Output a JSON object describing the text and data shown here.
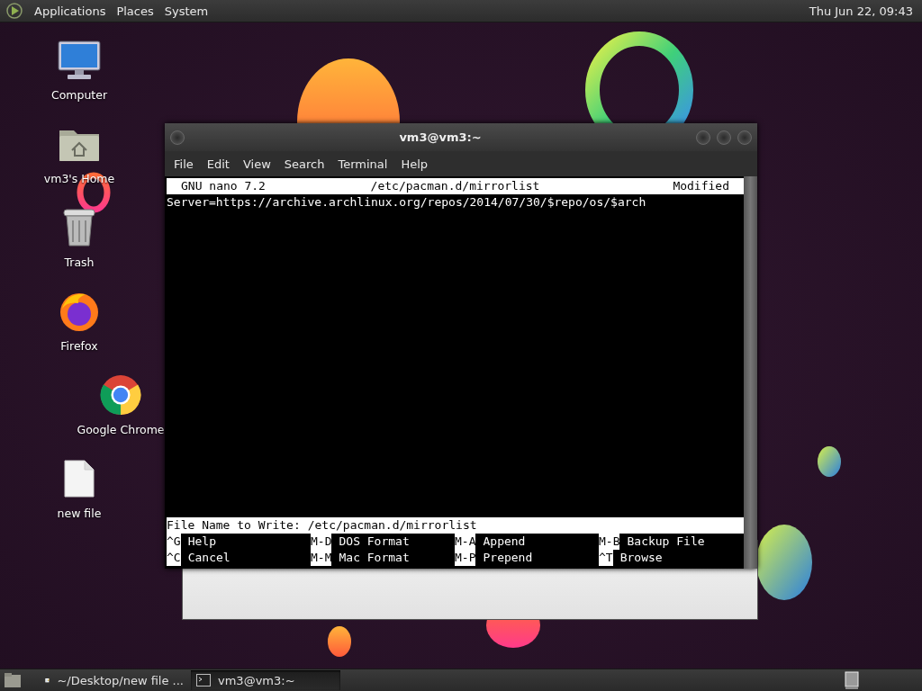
{
  "top_panel": {
    "menus": [
      "Applications",
      "Places",
      "System"
    ],
    "clock": "Thu Jun 22, 09:43"
  },
  "desktop_icons": [
    {
      "label": "Computer",
      "kind": "computer"
    },
    {
      "label": "vm3's Home",
      "kind": "home"
    },
    {
      "label": "Trash",
      "kind": "trash"
    },
    {
      "label": "Firefox",
      "kind": "firefox"
    },
    {
      "label": "Google Chrome",
      "kind": "chrome"
    },
    {
      "label": "new file",
      "kind": "file"
    }
  ],
  "terminal_window": {
    "title": "vm3@vm3:~",
    "menus": [
      "File",
      "Edit",
      "View",
      "Search",
      "Terminal",
      "Help"
    ],
    "nano": {
      "header": {
        "version": "GNU nano 7.2",
        "file": "/etc/pacman.d/mirrorlist",
        "status": "Modified"
      },
      "lines": [
        "Server=https://archive.archlinux.org/repos/2014/07/30/$repo/os/$arch"
      ],
      "prompt": {
        "label": "File Name to Write:",
        "value": "/etc/pacman.d/mirrorlist"
      },
      "shortcuts": [
        {
          "key": "^G",
          "label": "Help"
        },
        {
          "key": "M-D",
          "label": "DOS Format"
        },
        {
          "key": "M-A",
          "label": "Append"
        },
        {
          "key": "M-B",
          "label": "Backup File"
        },
        {
          "key": "^C",
          "label": "Cancel"
        },
        {
          "key": "M-M",
          "label": "Mac Format"
        },
        {
          "key": "M-P",
          "label": "Prepend"
        },
        {
          "key": "^T",
          "label": "Browse"
        }
      ]
    }
  },
  "taskbar": {
    "items": [
      {
        "label": "~/Desktop/new file ...",
        "kind": "editor",
        "selected": false
      },
      {
        "label": "vm3@vm3:~",
        "kind": "terminal",
        "selected": true
      }
    ]
  }
}
